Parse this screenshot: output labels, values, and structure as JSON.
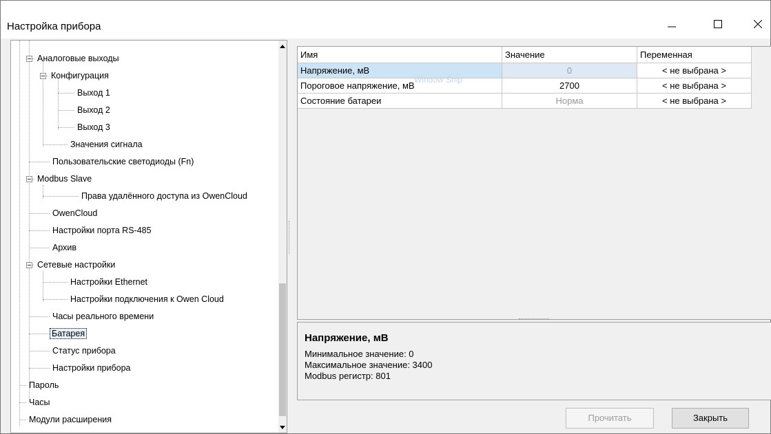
{
  "window": {
    "title": "Настройка прибора",
    "minimize": "—",
    "maximize": "☐",
    "close": "✕"
  },
  "tree": {
    "items": [
      {
        "label": "Аналоговые выходы"
      },
      {
        "label": "Конфигурация"
      },
      {
        "label": "Выход 1"
      },
      {
        "label": "Выход 2"
      },
      {
        "label": "Выход 3"
      },
      {
        "label": "Значения сигнала"
      },
      {
        "label": "Пользовательские светодиоды (Fn)"
      },
      {
        "label": "Modbus Slave"
      },
      {
        "label": "Права удалённого доступа из OwenCloud"
      },
      {
        "label": "OwenCloud"
      },
      {
        "label": "Настройки порта RS-485"
      },
      {
        "label": "Архив"
      },
      {
        "label": "Сетевые настройки"
      },
      {
        "label": "Настройки Ethernet"
      },
      {
        "label": "Настройки подключения к Owen Cloud"
      },
      {
        "label": "Часы реального времени"
      },
      {
        "label": "Батарея"
      },
      {
        "label": "Статус прибора"
      },
      {
        "label": "Настройки прибора"
      },
      {
        "label": "Пароль"
      },
      {
        "label": "Часы"
      },
      {
        "label": "Модули расширения"
      }
    ]
  },
  "grid": {
    "columns": [
      "Имя",
      "Значение",
      "Переменная"
    ],
    "rows": [
      {
        "name": "Напряжение, мВ",
        "value": "0",
        "variable": "< не выбрана >"
      },
      {
        "name": "Пороговое напряжение, мВ",
        "value": "2700",
        "variable": "< не выбрана >"
      },
      {
        "name": "Состояние батареи",
        "value": "Норма",
        "variable": "< не выбрана >"
      }
    ],
    "overlay": "Window Snip"
  },
  "description": {
    "title": "Напряжение, мВ",
    "lines": [
      "Минимальное значение: 0",
      "Максимальное значение: 3400",
      "Modbus регистр: 801"
    ]
  },
  "buttons": {
    "read": "Прочитать",
    "close": "Закрыть"
  }
}
